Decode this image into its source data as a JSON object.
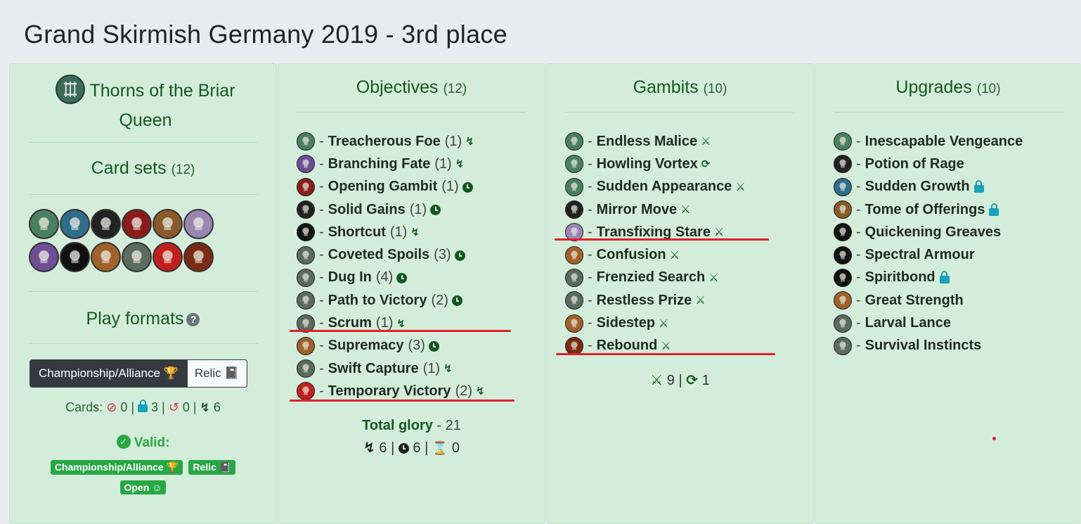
{
  "title": "Grand Skirmish Germany 2019 - 3rd place",
  "faction": {
    "name": "Thorns of the Briar Queen",
    "icon": "thorns-faction-icon"
  },
  "card_sets": {
    "label": "Card sets",
    "count": "(12)",
    "icons": [
      {
        "name": "nightvault-set-icon",
        "bg": "#4a8060"
      },
      {
        "name": "beastgrave-set-icon",
        "bg": "#2f6e8a"
      },
      {
        "name": "direchasm-set-icon",
        "bg": "#222222"
      },
      {
        "name": "arena-set-icon",
        "bg": "#8b1c1c"
      },
      {
        "name": "skull-mask-set-icon",
        "bg": "#8a5a2a"
      },
      {
        "name": "mushroom-set-icon",
        "bg": "#9b86b3"
      },
      {
        "name": "crystal-set-icon",
        "bg": "#6e4f95"
      },
      {
        "name": "hammers-set-icon",
        "bg": "#111111"
      },
      {
        "name": "mask-set-icon",
        "bg": "#a0622a"
      },
      {
        "name": "skull-set-icon",
        "bg": "#5b6b5d"
      },
      {
        "name": "sun-set-icon",
        "bg": "#c21f1f"
      },
      {
        "name": "demon-set-icon",
        "bg": "#7a2b14"
      }
    ]
  },
  "play_formats": {
    "label": "Play formats",
    "help": "?",
    "btn_championship": "Championship/Alliance 🏆",
    "btn_relic": "Relic 📓"
  },
  "cards_stats": {
    "label": "Cards:",
    "banned": "0",
    "restricted": "3",
    "rotated": "0",
    "surge": "6"
  },
  "validity": {
    "label": "Valid:",
    "badges": [
      "Championship/Alliance 🏆",
      "Relic 📓",
      "Open ☺"
    ]
  },
  "objectives": {
    "label": "Objectives",
    "count": "(12)",
    "items": [
      {
        "name": "Treacherous Foe",
        "glory": "(1)",
        "type": "surge",
        "icon": "#4a8060"
      },
      {
        "name": "Branching Fate",
        "glory": "(1)",
        "type": "surge",
        "icon": "#6e4f95"
      },
      {
        "name": "Opening Gambit",
        "glory": "(1)",
        "type": "end",
        "icon": "#8b1c1c"
      },
      {
        "name": "Solid Gains",
        "glory": "(1)",
        "type": "end",
        "icon": "#222222"
      },
      {
        "name": "Shortcut",
        "glory": "(1)",
        "type": "surge",
        "icon": "#111111"
      },
      {
        "name": "Coveted Spoils",
        "glory": "(3)",
        "type": "end",
        "icon": "#5b6b5d"
      },
      {
        "name": "Dug In",
        "glory": "(4)",
        "type": "end",
        "icon": "#5b6b5d"
      },
      {
        "name": "Path to Victory",
        "glory": "(2)",
        "type": "end",
        "icon": "#5b6b5d"
      },
      {
        "name": "Scrum",
        "glory": "(1)",
        "type": "surge",
        "icon": "#5b6b5d"
      },
      {
        "name": "Supremacy",
        "glory": "(3)",
        "type": "end",
        "icon": "#a0622a"
      },
      {
        "name": "Swift Capture",
        "glory": "(1)",
        "type": "surge",
        "icon": "#5b6b5d"
      },
      {
        "name": "Temporary Victory",
        "glory": "(2)",
        "type": "surge",
        "icon": "#c21f1f"
      }
    ],
    "total_label": "Total glory",
    "total_value": "- 21",
    "surge_count": "6",
    "end_count": "6",
    "third_count": "0"
  },
  "gambits": {
    "label": "Gambits",
    "count": "(10)",
    "items": [
      {
        "name": "Endless Malice",
        "type": "ploy",
        "icon": "#4a8060"
      },
      {
        "name": "Howling Vortex",
        "type": "spell",
        "icon": "#4a8060"
      },
      {
        "name": "Sudden Appearance",
        "type": "ploy",
        "icon": "#4a8060"
      },
      {
        "name": "Mirror Move",
        "type": "ploy",
        "icon": "#222222"
      },
      {
        "name": "Transfixing Stare",
        "type": "ploy",
        "icon": "#9b86b3"
      },
      {
        "name": "Confusion",
        "type": "ploy",
        "icon": "#a0622a"
      },
      {
        "name": "Frenzied Search",
        "type": "ploy",
        "icon": "#5b6b5d"
      },
      {
        "name": "Restless Prize",
        "type": "ploy",
        "icon": "#5b6b5d"
      },
      {
        "name": "Sidestep",
        "type": "ploy",
        "icon": "#a0622a"
      },
      {
        "name": "Rebound",
        "type": "ploy",
        "icon": "#7a2b14"
      }
    ],
    "ploy_count": "9",
    "spell_count": "1"
  },
  "upgrades": {
    "label": "Upgrades",
    "count": "(10)",
    "items": [
      {
        "name": "Inescapable Vengeance",
        "restricted": false,
        "icon": "#4a8060"
      },
      {
        "name": "Potion of Rage",
        "restricted": false,
        "icon": "#222222"
      },
      {
        "name": "Sudden Growth",
        "restricted": true,
        "icon": "#2f6e8a"
      },
      {
        "name": "Tome of Offerings",
        "restricted": true,
        "icon": "#8a5a2a"
      },
      {
        "name": "Quickening Greaves",
        "restricted": false,
        "icon": "#111111"
      },
      {
        "name": "Spectral Armour",
        "restricted": false,
        "icon": "#111111"
      },
      {
        "name": "Spiritbond",
        "restricted": true,
        "icon": "#111111"
      },
      {
        "name": "Great Strength",
        "restricted": false,
        "icon": "#a0622a"
      },
      {
        "name": "Larval Lance",
        "restricted": false,
        "icon": "#5b6b5d"
      },
      {
        "name": "Survival Instincts",
        "restricted": false,
        "icon": "#5b6b5d"
      }
    ]
  },
  "colors": {
    "panel_bg": "#d4edda",
    "heading": "#155724",
    "valid": "#28a745",
    "restricted": "#17a2b8",
    "annotation": "#e0202b"
  }
}
